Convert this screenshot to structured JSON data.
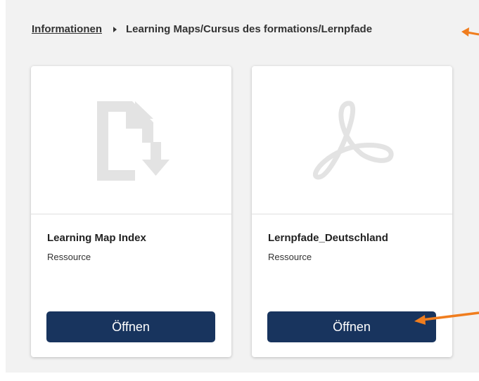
{
  "breadcrumb": {
    "link": "Informationen",
    "separator_icon": "caret-right-icon",
    "current": "Learning Maps/Cursus des formations/Lernpfade"
  },
  "cards": [
    {
      "title": "Learning Map Index",
      "type": "Ressource",
      "button": "Öffnen",
      "icon": "file-download-icon"
    },
    {
      "title": "Lernpfade_Deutschland",
      "type": "Ressource",
      "button": "Öffnen",
      "icon": "pdf-icon"
    }
  ],
  "annotations": {
    "arrow_color": "#f07d1e"
  },
  "colors": {
    "button": "#18345e",
    "background": "#f2f2f2",
    "icon": "#e3e3e3"
  }
}
